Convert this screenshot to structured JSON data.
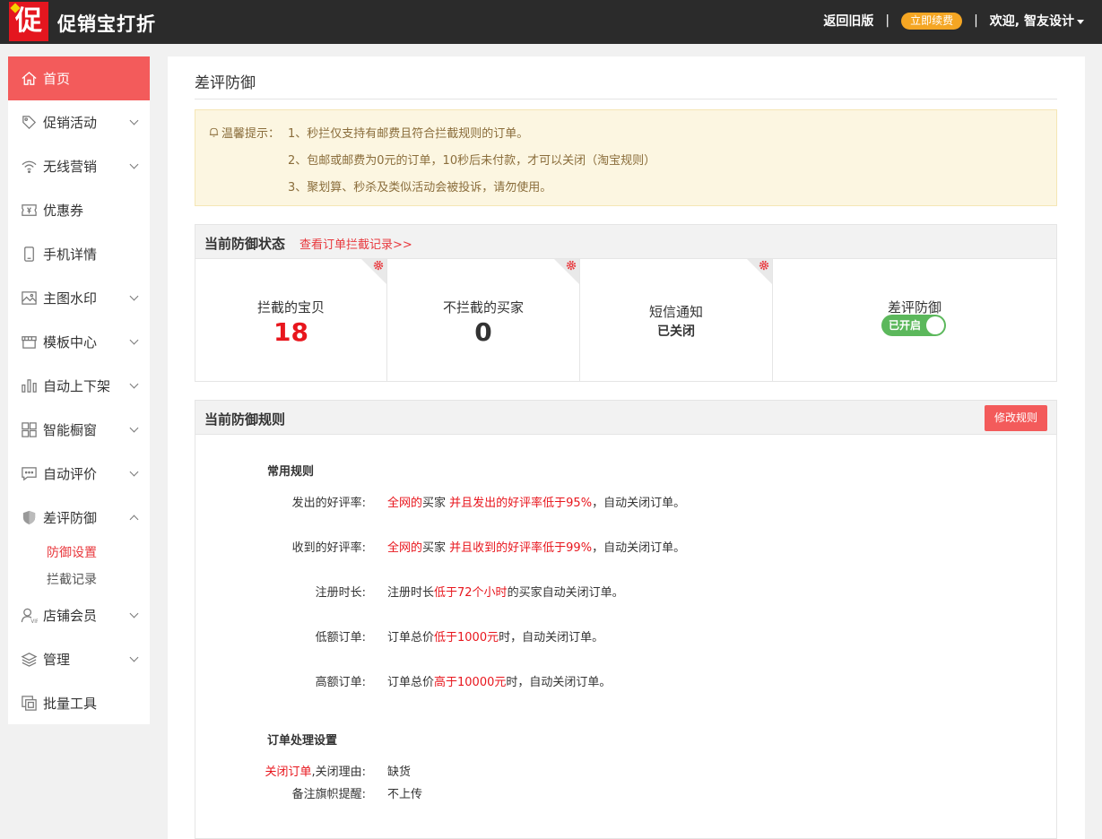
{
  "header": {
    "logo_char": "促",
    "app_title": "促销宝打折",
    "back_old": "返回旧版",
    "separator": "|",
    "renew": "立即续费",
    "welcome": "欢迎, 智友设计"
  },
  "sidebar": {
    "items": [
      {
        "label": "首页",
        "icon": "home-icon"
      },
      {
        "label": "促销活动",
        "icon": "tag-icon"
      },
      {
        "label": "无线营销",
        "icon": "wifi-icon"
      },
      {
        "label": "优惠券",
        "icon": "coupon-icon"
      },
      {
        "label": "手机详情",
        "icon": "phone-icon"
      },
      {
        "label": "主图水印",
        "icon": "image-icon"
      },
      {
        "label": "模板中心",
        "icon": "store-icon"
      },
      {
        "label": "自动上下架",
        "icon": "bars-icon"
      },
      {
        "label": "智能橱窗",
        "icon": "grid-icon"
      },
      {
        "label": "自动评价",
        "icon": "comment-icon"
      },
      {
        "label": "差评防御",
        "icon": "shield-icon"
      },
      {
        "label": "店铺会员",
        "icon": "vip-user-icon"
      },
      {
        "label": "管理",
        "icon": "layers-icon"
      },
      {
        "label": "批量工具",
        "icon": "copy-icon"
      }
    ],
    "sub_items": [
      {
        "label": "防御设置"
      },
      {
        "label": "拦截记录"
      }
    ]
  },
  "page": {
    "title": "差评防御",
    "tip_label": "温馨提示：",
    "tips": [
      "1、秒拦仅支持有邮费且符合拦截规则的订单。",
      "2、包邮或邮费为0元的订单，10秒后未付款，才可以关闭（淘宝规则）",
      "3、聚划算、秒杀及类似活动会被投诉，请勿使用。"
    ]
  },
  "status_panel": {
    "title": "当前防御状态",
    "link": "查看订单拦截记录>>",
    "stats": [
      {
        "label": "拦截的宝贝",
        "value": "18"
      },
      {
        "label": "不拦截的买家",
        "value": "0"
      },
      {
        "label": "短信通知",
        "value": "已关闭"
      },
      {
        "label": "差评防御",
        "toggle": "已开启"
      }
    ]
  },
  "rules_panel": {
    "title": "当前防御规则",
    "modify_button": "修改规则",
    "common_title": "常用规则",
    "rules": [
      {
        "label": "发出的好评率:",
        "parts": [
          "全网的",
          "买家 ",
          "并且发出的好评率低于95%",
          "，自动关闭订单。"
        ]
      },
      {
        "label": "收到的好评率:",
        "parts": [
          "全网的",
          "买家 ",
          "并且收到的好评率低于99%",
          "，自动关闭订单。"
        ]
      },
      {
        "label": "注册时长:",
        "parts": [
          "注册时长",
          "低于72个小时",
          "的买家自动关闭订单。"
        ]
      },
      {
        "label": "低额订单:",
        "parts": [
          "订单总价",
          "低于1000元",
          "时，自动关闭订单。"
        ]
      },
      {
        "label": "高额订单:",
        "parts": [
          "订单总价",
          "高于10000元",
          "时，自动关闭订单。"
        ]
      }
    ],
    "order_title": "订单处理设置",
    "close_order_red": "关闭订单",
    "close_order_label": ",关闭理由:",
    "close_order_value": "缺货",
    "flag_label": "备注旗帜提醒:",
    "flag_value": "不上传"
  },
  "colors": {
    "accent": "#f35b5b",
    "red_text": "#e8161d",
    "topbar": "#2b2b2b",
    "renew": "#f5a623",
    "toggle_on": "#5cb85c"
  }
}
